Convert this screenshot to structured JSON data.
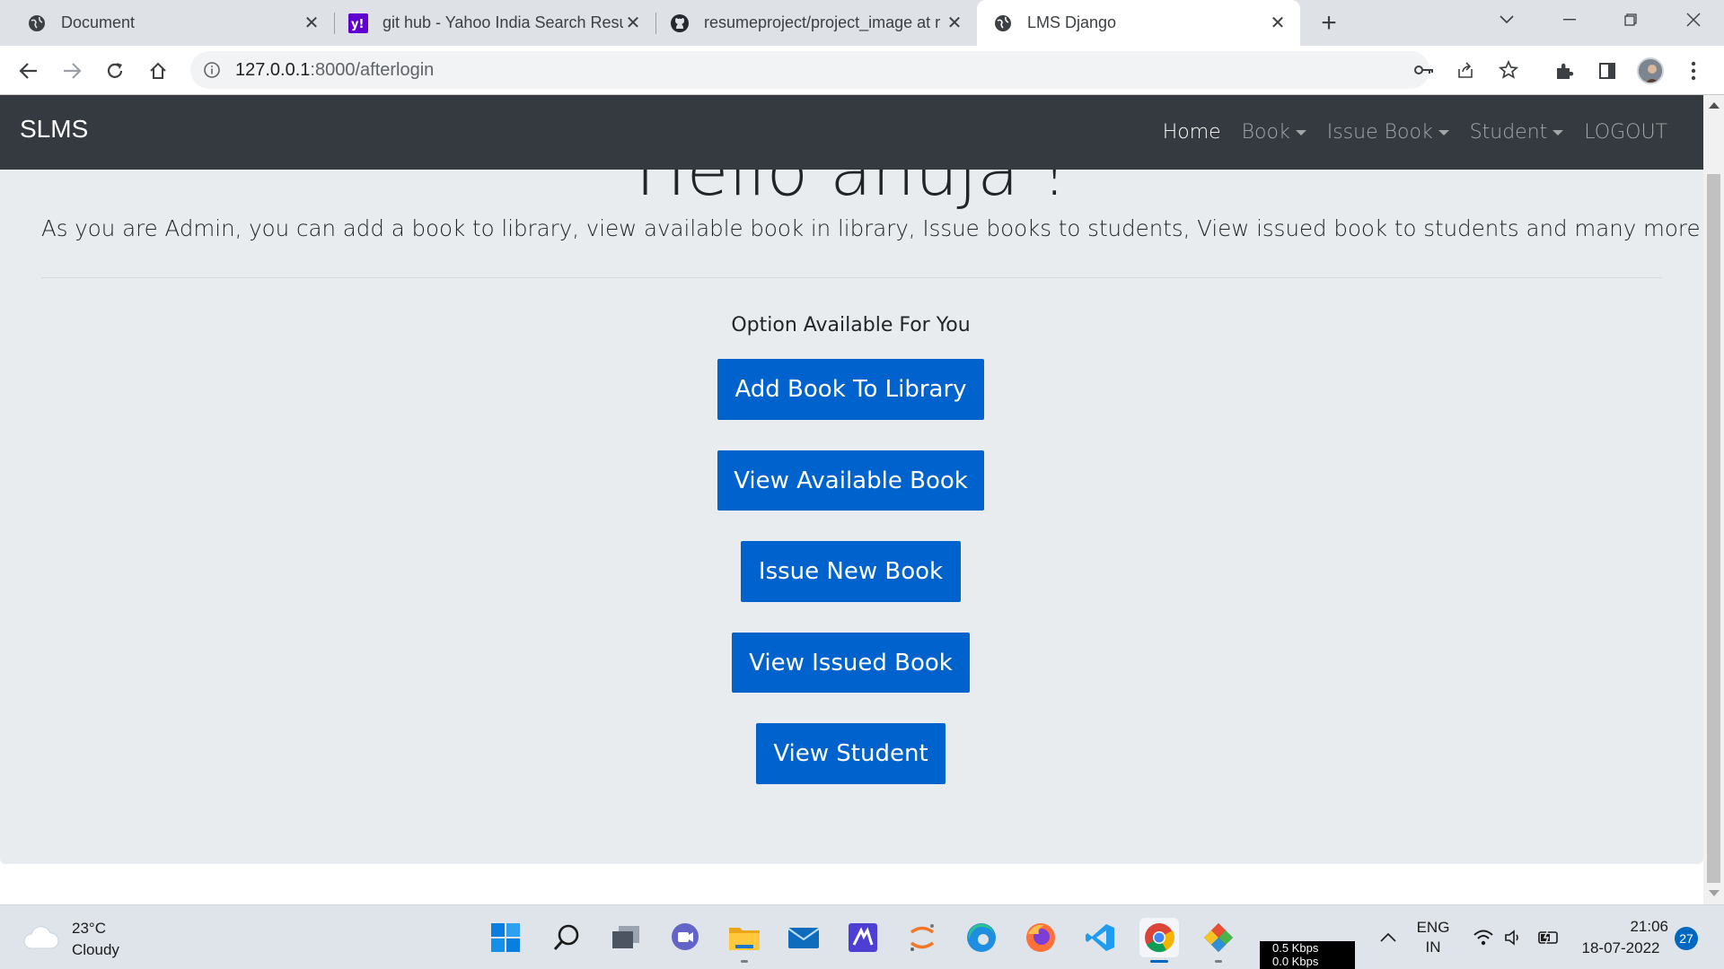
{
  "browser": {
    "tabs": [
      {
        "title": "Document",
        "icon": "globe-icon",
        "active": false
      },
      {
        "title": "git hub - Yahoo India Search Resu",
        "icon": "yahoo-icon",
        "active": false
      },
      {
        "title": "resumeproject/project_image at r",
        "icon": "github-icon",
        "active": false
      },
      {
        "title": "LMS Django",
        "icon": "globe-icon",
        "active": true
      }
    ],
    "url_host": "127.0.0.1",
    "url_path": ":8000/afterlogin"
  },
  "app": {
    "brand": "SLMS",
    "nav": {
      "home": "Home",
      "book": "Book",
      "issue_book": "Issue Book",
      "student": "Student",
      "logout": "LOGOUT"
    },
    "greeting": "Hello anuja !",
    "lead": "As you are Admin, you can add a book to library, view available book in library, Issue books to students, View issued book to students and many more ... !",
    "options_label": "Option Available For You",
    "buttons": {
      "add_book": "Add Book To Library",
      "view_available": "View Available Book",
      "issue_new": "Issue New Book",
      "view_issued": "View Issued Book",
      "view_student": "View Student"
    },
    "colors": {
      "navbar": "#343a40",
      "button": "#0062cc",
      "jumbotron": "#e9ecef"
    }
  },
  "taskbar": {
    "weather_temp": "23°C",
    "weather_desc": "Cloudy",
    "net_up": "0.5 Kbps",
    "net_down": "0.0 Kbps",
    "lang_1": "ENG",
    "lang_2": "IN",
    "time": "21:06",
    "date": "18-07-2022",
    "notifications": "27"
  }
}
